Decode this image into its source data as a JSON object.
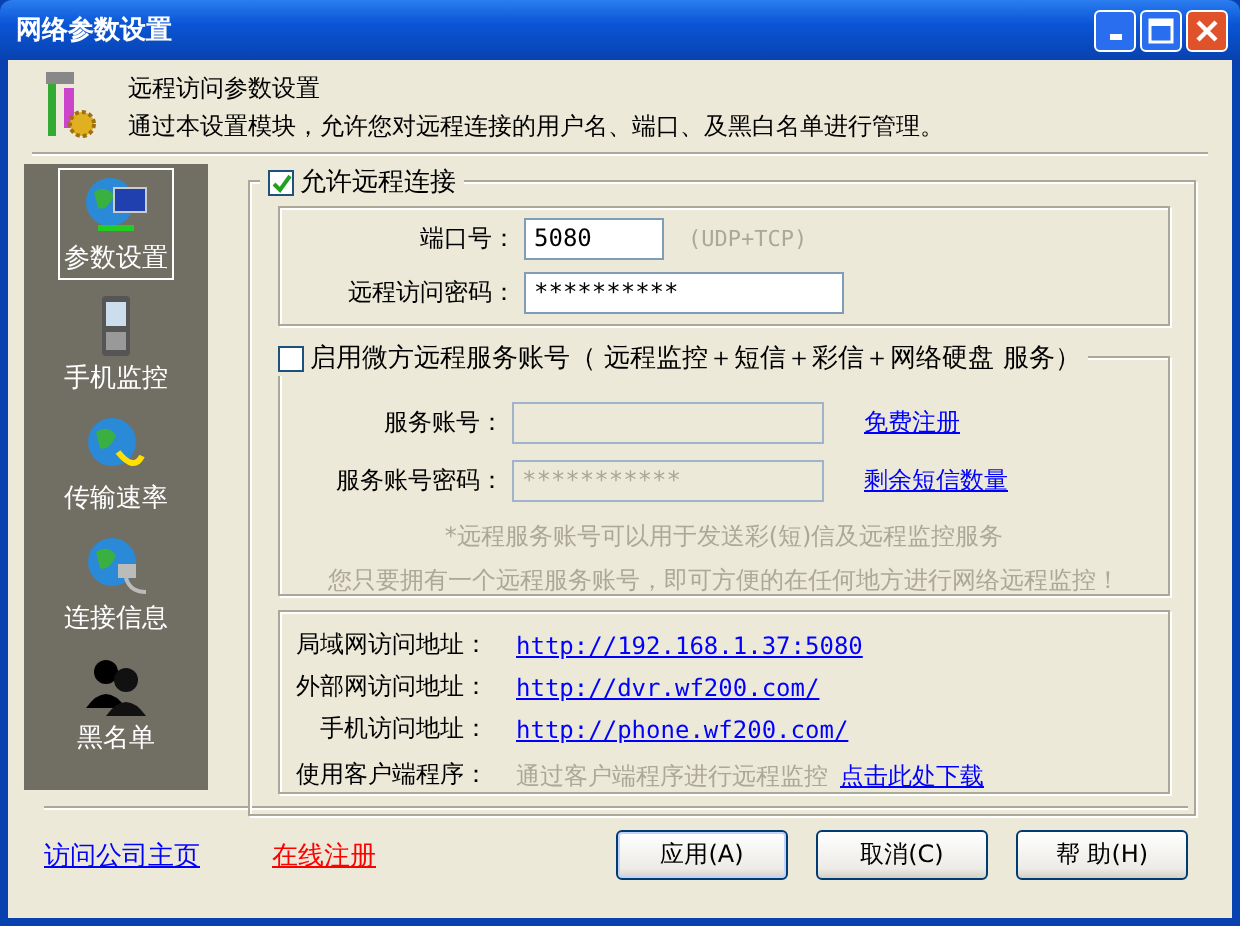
{
  "window": {
    "title": "网络参数设置"
  },
  "header": {
    "title": "远程访问参数设置",
    "description": "通过本设置模块，允许您对远程连接的用户名、端口、及黑白名单进行管理。"
  },
  "sidebar": {
    "items": [
      {
        "label": "参数设置",
        "selected": true
      },
      {
        "label": "手机监控",
        "selected": false
      },
      {
        "label": "传输速率",
        "selected": false
      },
      {
        "label": "连接信息",
        "selected": false
      },
      {
        "label": "黑名单",
        "selected": false
      }
    ]
  },
  "allow_remote": {
    "label": "允许远程连接",
    "checked": true
  },
  "port": {
    "label": "端口号：",
    "value": "5080",
    "note": "(UDP+TCP)"
  },
  "password": {
    "label": "远程访问密码：",
    "value": "**********"
  },
  "service_account": {
    "label": "启用微方远程服务账号（ 远程监控＋短信＋彩信＋网络硬盘  服务）",
    "checked": false,
    "account": {
      "label": "服务账号：",
      "link": "免费注册"
    },
    "account_password": {
      "label": "服务账号密码：",
      "value": "***********",
      "link": "剩余短信数量"
    },
    "notes": [
      "*远程服务账号可以用于发送彩(短)信及远程监控服务",
      "您只要拥有一个远程服务账号，即可方便的在任何地方进行网络远程监控！"
    ]
  },
  "addresses": [
    {
      "label": "局域网访问地址：",
      "url": "http://192.168.1.37:5080"
    },
    {
      "label": "外部网访问地址：",
      "url": "http://dvr.wf200.com/"
    },
    {
      "label": "手机访问地址：",
      "url": "http://phone.wf200.com/"
    }
  ],
  "client": {
    "label": "使用客户端程序：",
    "text": "通过客户端程序进行远程监控",
    "link": "点击此处下载"
  },
  "footer_links": [
    {
      "label": "访问公司主页",
      "color": "#0000ff"
    },
    {
      "label": "在线注册",
      "color": "#ff0000"
    }
  ],
  "buttons": [
    {
      "label": "应用(A)"
    },
    {
      "label": "取消(C)"
    },
    {
      "label": "帮 助(H)"
    }
  ]
}
